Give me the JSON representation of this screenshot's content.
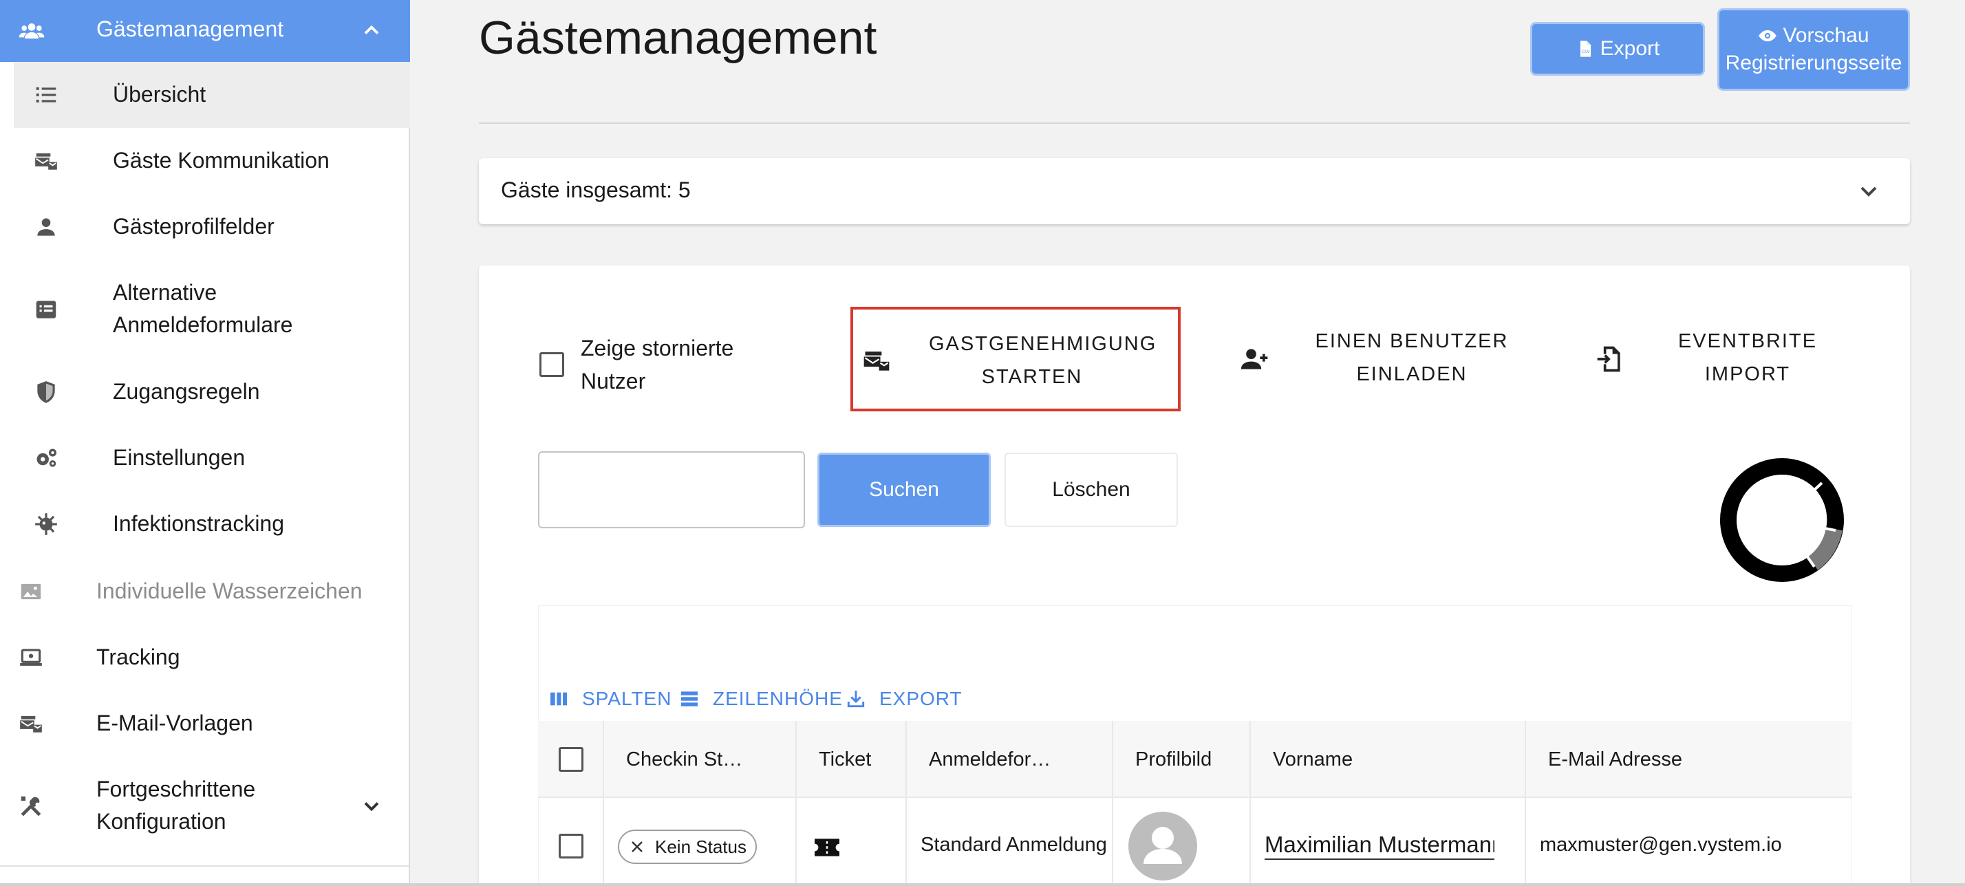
{
  "sidebar": {
    "header": {
      "label": "Gästemanagement",
      "icon": "users-icon"
    },
    "sub_items": [
      {
        "label": "Übersicht",
        "icon": "list-icon",
        "active": true
      },
      {
        "label": "Gäste Kommunikation",
        "icon": "mail-communication-icon"
      },
      {
        "label": "Gästeprofilfelder",
        "icon": "person-icon"
      },
      {
        "label": "Alternative Anmeldeformulare",
        "icon": "form-list-icon"
      },
      {
        "label": "Zugangsregeln",
        "icon": "shield-icon"
      },
      {
        "label": "Einstellungen",
        "icon": "gears-icon"
      },
      {
        "label": "Infektionstracking",
        "icon": "virus-icon"
      }
    ],
    "top_items": [
      {
        "label": "Individuelle Wasserzeichen",
        "icon": "image-icon",
        "disabled": true
      },
      {
        "label": "Tracking",
        "icon": "laptop-icon"
      },
      {
        "label": "E-Mail-Vorlagen",
        "icon": "mail-template-icon"
      },
      {
        "label": "Fortgeschrittene Konfiguration",
        "icon": "tools-icon"
      }
    ]
  },
  "header": {
    "title": "Gästemanagement",
    "export_label": "Export",
    "preview_label_1": "Vorschau",
    "preview_label_2": "Registrierungsseite"
  },
  "summary": {
    "text": "Gäste insgesamt: 5"
  },
  "actions": {
    "show_cancelled": "Zeige stornierte Nutzer",
    "guest_approval": "GASTGENEHMIGUNG STARTEN",
    "invite_user": "EINEN BENUTZER EINLADEN",
    "eventbrite": "EVENTBRITE IMPORT"
  },
  "search": {
    "value": "",
    "placeholder": "",
    "search_label": "Suchen",
    "clear_label": "Löschen"
  },
  "toolbar": {
    "columns": "SPALTEN",
    "row_height": "ZEILENHÖHE",
    "export": "EXPORT"
  },
  "table": {
    "columns": [
      "Checkin St…",
      "Ticket",
      "Anmeldefor…",
      "Profilbild",
      "Vorname",
      "E-Mail Adresse"
    ],
    "rows": [
      {
        "status": "Kein Status",
        "form": "Standard Anmeldung",
        "first_name": "Maximilian Mustermann",
        "email": "maxmuster@gen.vystem.io"
      }
    ]
  },
  "colors": {
    "accent": "#5e97ec",
    "highlight": "#d9382c",
    "link": "#4a86e8"
  }
}
